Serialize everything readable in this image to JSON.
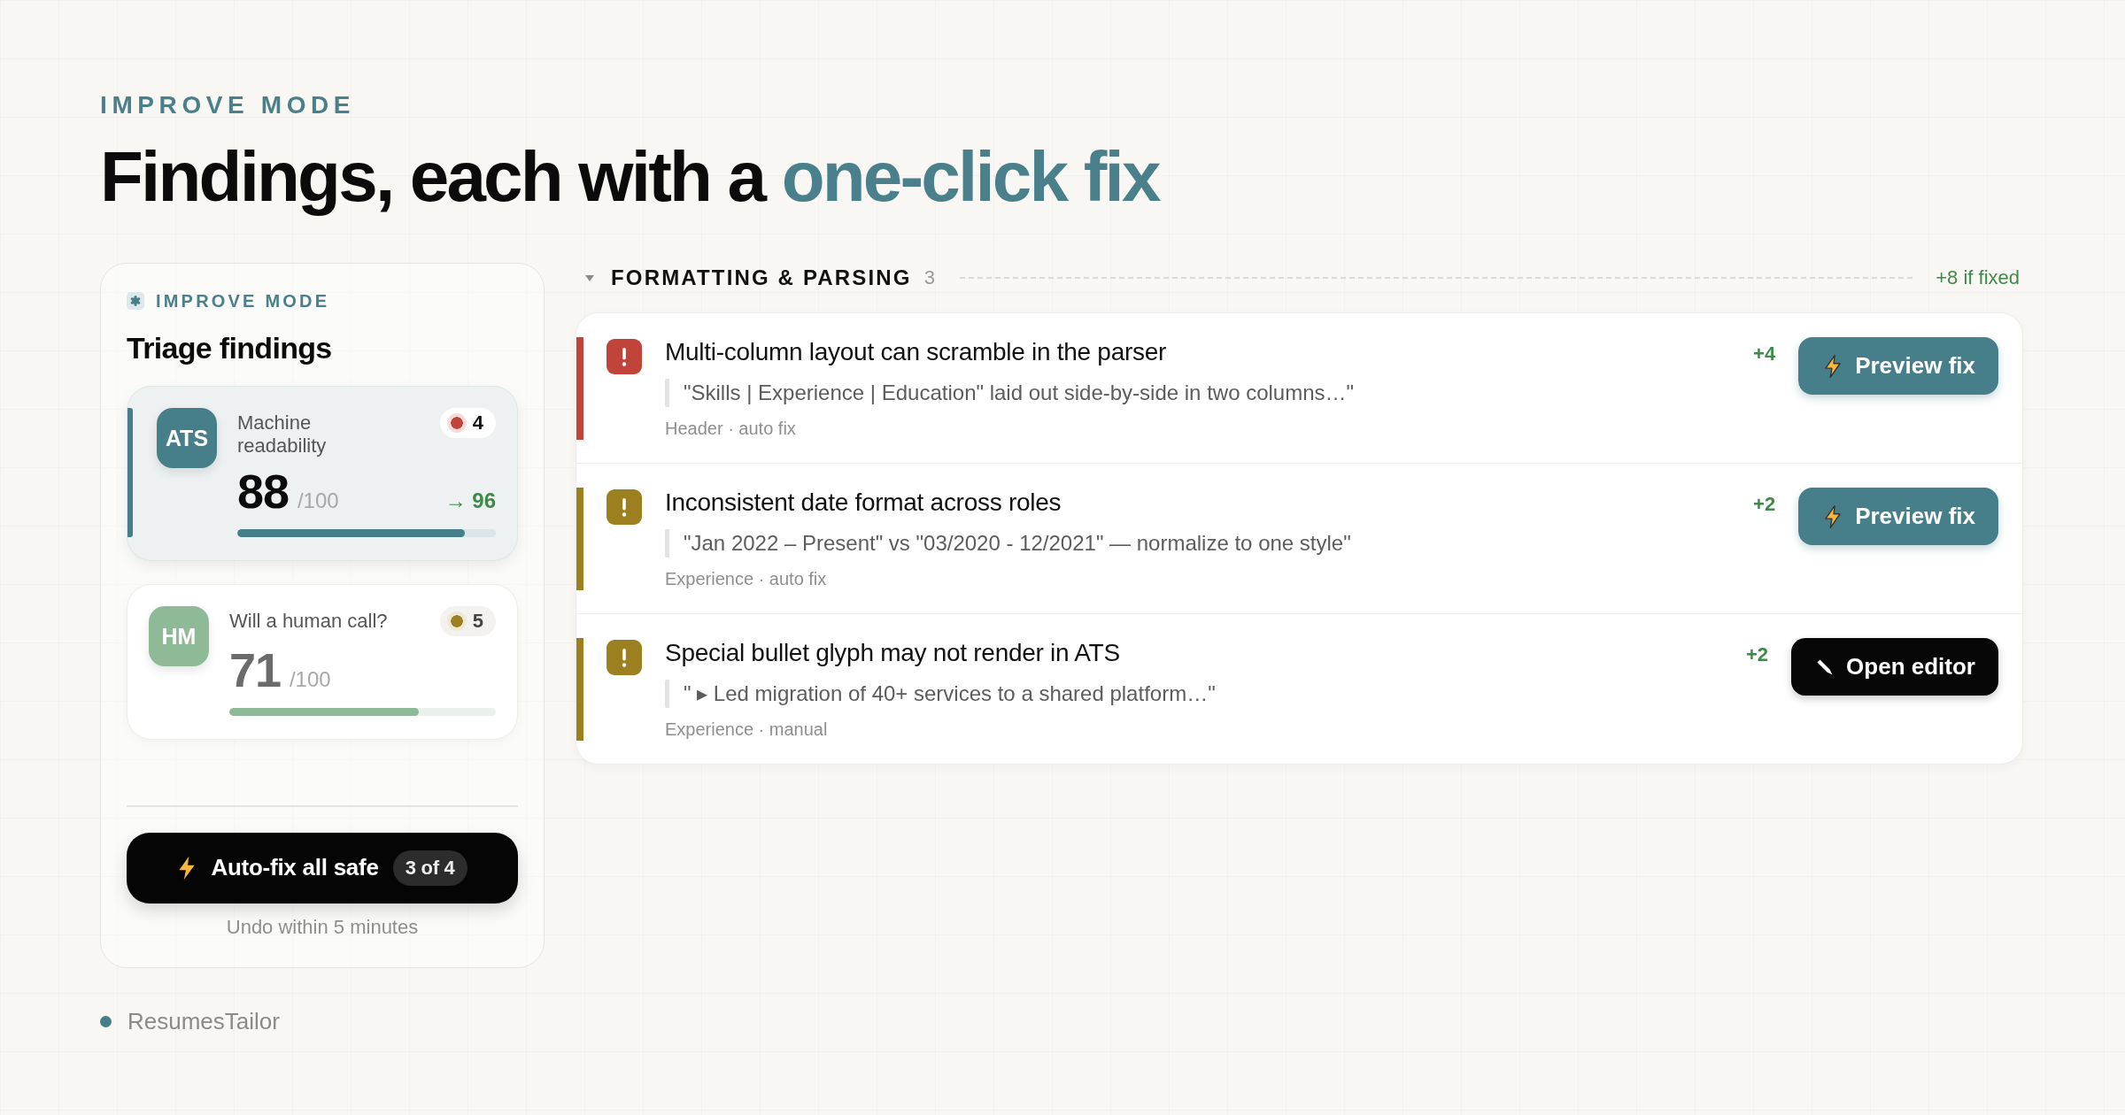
{
  "eyebrow": "IMPROVE MODE",
  "heading": {
    "text": "Findings, each with a",
    "highlight": "one-click fix"
  },
  "panel": {
    "eyebrow": "IMPROVE MODE",
    "title": "Triage findings",
    "scores": [
      {
        "badge": "ATS",
        "label": "Machine readability",
        "color": "#467e89",
        "selected": true,
        "count": {
          "text": "4",
          "color": "#c0443a"
        },
        "score": "88",
        "out_of": "/100",
        "target": "→ 96",
        "level": 0.88
      },
      {
        "badge": "HM",
        "label": "Will a human call?",
        "color": "#8fba98",
        "selected": false,
        "count": {
          "text": "5",
          "color": "#9c7f1e"
        },
        "score": "71",
        "out_of": "/100",
        "level": 0.71
      }
    ],
    "action": {
      "label": "Auto-fix all safe",
      "badge": "3 of 4"
    },
    "note": "Undo within 5 minutes"
  },
  "brand": "ResumesTailor",
  "section": {
    "title": "FORMATTING & PARSING",
    "count": "3",
    "expanded": true,
    "gain": "+8 if fixed",
    "findings": [
      {
        "color": "#c0443a",
        "title": "Multi-column layout can scramble in the parser",
        "quote": "\"Skills | Experience | Education\" laid out side-by-side in two columns…\"",
        "meta": "Header · auto fix",
        "gain": "+4",
        "action": {
          "kind": "preview",
          "label": "Preview fix"
        }
      },
      {
        "color": "#9c7f1e",
        "title": "Inconsistent date format across roles",
        "quote": "\"Jan 2022 – Present\" vs \"03/2020 - 12/2021\" — normalize to one style\"",
        "meta": "Experience · auto fix",
        "gain": "+2",
        "action": {
          "kind": "preview",
          "label": "Preview fix"
        }
      },
      {
        "color": "#9c7f1e",
        "title": "Special bullet glyph may not render in ATS",
        "quote": "\" ▸ Led migration of 40+ services to a shared platform…\"",
        "meta": "Experience · manual",
        "gain": "+2",
        "action": {
          "kind": "editor",
          "label": "Open editor"
        }
      }
    ]
  }
}
